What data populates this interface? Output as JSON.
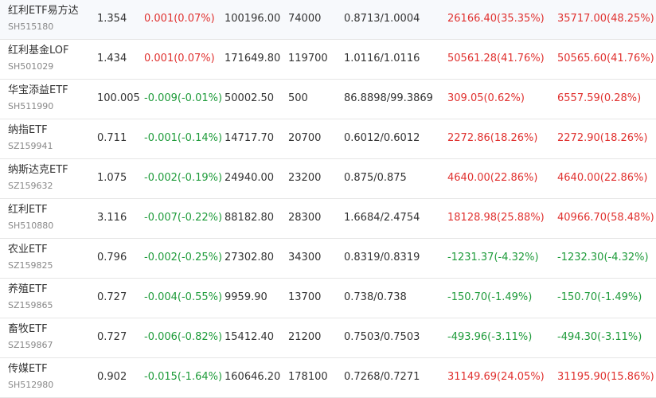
{
  "colors": {
    "up": "#e0312f",
    "down": "#1e9b3a"
  },
  "rows": [
    {
      "name": "红利ETF易方达",
      "code": "SH515180",
      "price": "1.354",
      "change": "0.001(0.07%)",
      "change_dir": "up",
      "col3": "100196.00",
      "col4": "74000",
      "col5": "0.8713/1.0004",
      "col6": "26166.40(35.35%)",
      "col6_dir": "up",
      "col7": "35717.00(48.25%)",
      "col7_dir": "up"
    },
    {
      "name": "红利基金LOF",
      "code": "SH501029",
      "price": "1.434",
      "change": "0.001(0.07%)",
      "change_dir": "up",
      "col3": "171649.80",
      "col4": "119700",
      "col5": "1.0116/1.0116",
      "col6": "50561.28(41.76%)",
      "col6_dir": "up",
      "col7": "50565.60(41.76%)",
      "col7_dir": "up"
    },
    {
      "name": "华宝添益ETF",
      "code": "SH511990",
      "price": "100.005",
      "change": "-0.009(-0.01%)",
      "change_dir": "down",
      "col3": "50002.50",
      "col4": "500",
      "col5": "86.8898/99.3869",
      "col6": "309.05(0.62%)",
      "col6_dir": "up",
      "col7": "6557.59(0.28%)",
      "col7_dir": "up"
    },
    {
      "name": "纳指ETF",
      "code": "SZ159941",
      "price": "0.711",
      "change": "-0.001(-0.14%)",
      "change_dir": "down",
      "col3": "14717.70",
      "col4": "20700",
      "col5": "0.6012/0.6012",
      "col6": "2272.86(18.26%)",
      "col6_dir": "up",
      "col7": "2272.90(18.26%)",
      "col7_dir": "up"
    },
    {
      "name": "纳斯达克ETF",
      "code": "SZ159632",
      "price": "1.075",
      "change": "-0.002(-0.19%)",
      "change_dir": "down",
      "col3": "24940.00",
      "col4": "23200",
      "col5": "0.875/0.875",
      "col6": "4640.00(22.86%)",
      "col6_dir": "up",
      "col7": "4640.00(22.86%)",
      "col7_dir": "up"
    },
    {
      "name": "红利ETF",
      "code": "SH510880",
      "price": "3.116",
      "change": "-0.007(-0.22%)",
      "change_dir": "down",
      "col3": "88182.80",
      "col4": "28300",
      "col5": "1.6684/2.4754",
      "col6": "18128.98(25.88%)",
      "col6_dir": "up",
      "col7": "40966.70(58.48%)",
      "col7_dir": "up"
    },
    {
      "name": "农业ETF",
      "code": "SZ159825",
      "price": "0.796",
      "change": "-0.002(-0.25%)",
      "change_dir": "down",
      "col3": "27302.80",
      "col4": "34300",
      "col5": "0.8319/0.8319",
      "col6": "-1231.37(-4.32%)",
      "col6_dir": "down",
      "col7": "-1232.30(-4.32%)",
      "col7_dir": "down"
    },
    {
      "name": "养殖ETF",
      "code": "SZ159865",
      "price": "0.727",
      "change": "-0.004(-0.55%)",
      "change_dir": "down",
      "col3": "9959.90",
      "col4": "13700",
      "col5": "0.738/0.738",
      "col6": "-150.70(-1.49%)",
      "col6_dir": "down",
      "col7": "-150.70(-1.49%)",
      "col7_dir": "down"
    },
    {
      "name": "畜牧ETF",
      "code": "SZ159867",
      "price": "0.727",
      "change": "-0.006(-0.82%)",
      "change_dir": "down",
      "col3": "15412.40",
      "col4": "21200",
      "col5": "0.7503/0.7503",
      "col6": "-493.96(-3.11%)",
      "col6_dir": "down",
      "col7": "-494.30(-3.11%)",
      "col7_dir": "down"
    },
    {
      "name": "传媒ETF",
      "code": "SH512980",
      "price": "0.902",
      "change": "-0.015(-1.64%)",
      "change_dir": "down",
      "col3": "160646.20",
      "col4": "178100",
      "col5": "0.7268/0.7271",
      "col6": "31149.69(24.05%)",
      "col6_dir": "up",
      "col7": "31195.90(15.86%)",
      "col7_dir": "up"
    }
  ]
}
